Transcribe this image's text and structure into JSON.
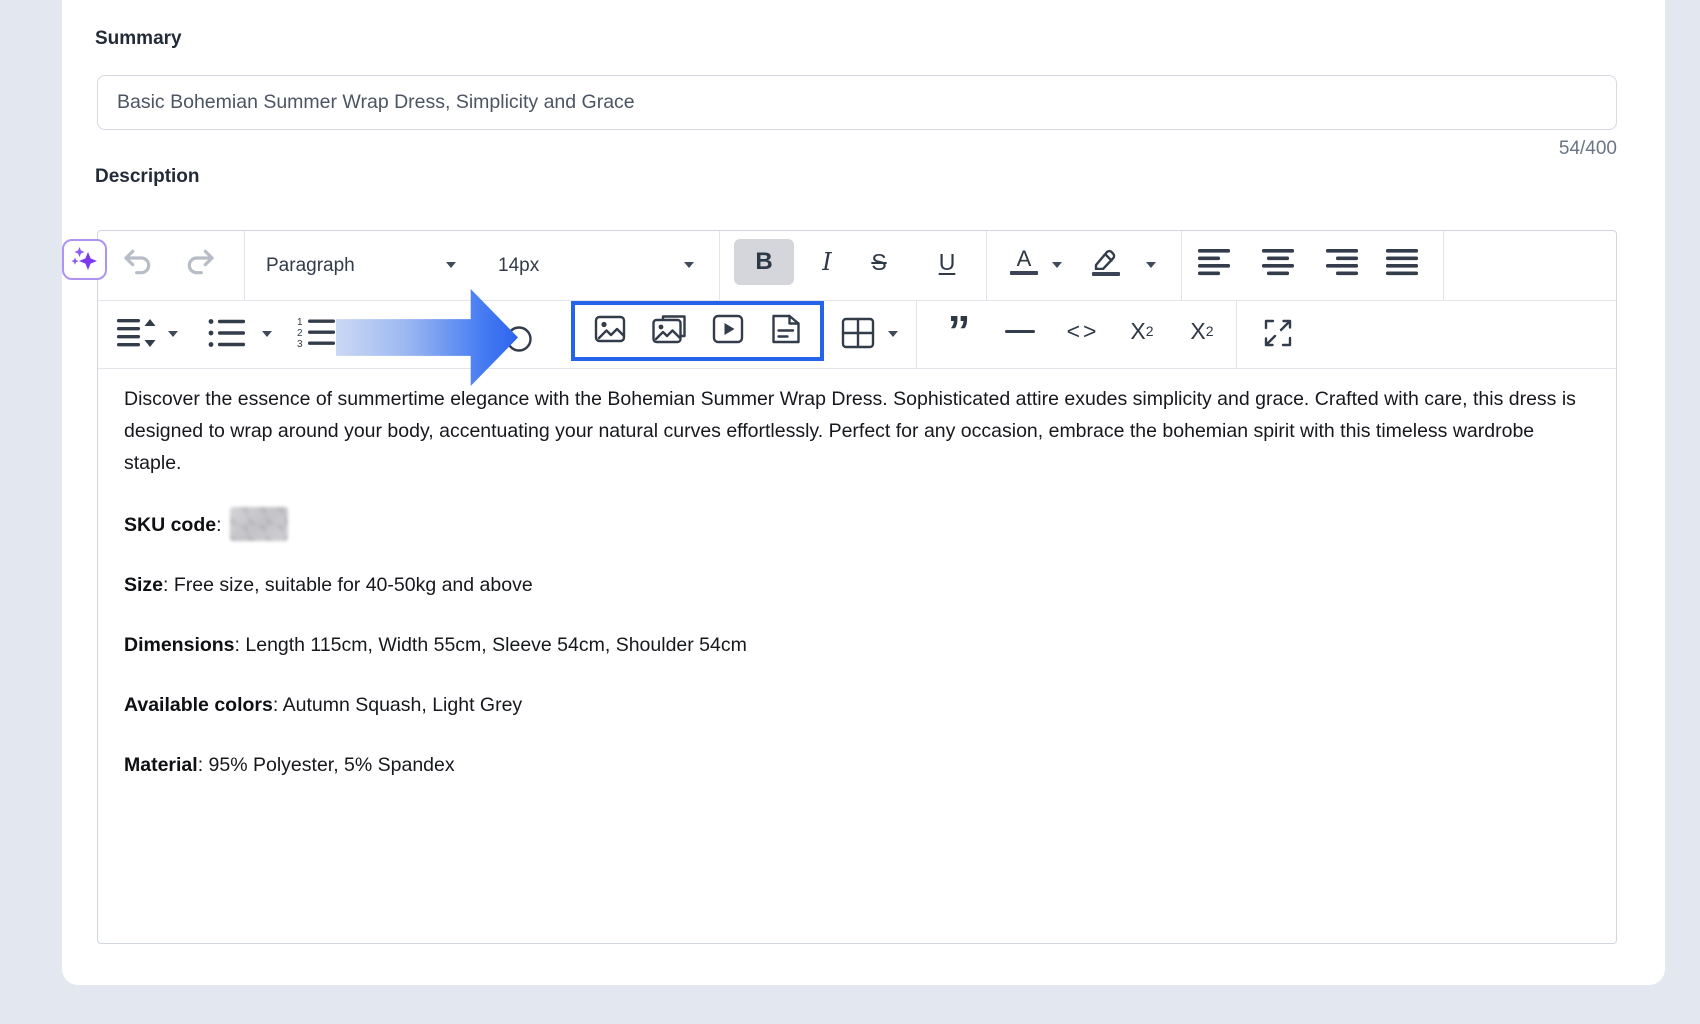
{
  "page": {
    "background": "#e3e7f0",
    "card_background": "#ffffff"
  },
  "summary": {
    "label": "Summary",
    "value": "Basic Bohemian Summer Wrap Dress, Simplicity and Grace",
    "counter": "54/400"
  },
  "description": {
    "label": "Description"
  },
  "toolbar": {
    "paragraph_dropdown": "Paragraph",
    "fontsize_dropdown": "14px",
    "bold": "B",
    "italic": "I",
    "strikethrough": "S",
    "underline": "U",
    "forecolor": "A",
    "code": "<>",
    "superscript_base": "X",
    "superscript_script": "2",
    "subscript_base": "X",
    "subscript_script": "2",
    "quote_glyph": "”",
    "numbered_digits": [
      "1",
      "2",
      "3"
    ]
  },
  "editor": {
    "paragraph": "Discover the essence of summertime elegance with the Bohemian Summer Wrap Dress. Sophisticated attire exudes simplicity and grace. Crafted with care, this dress is designed to wrap around your body, accentuating your natural curves effortlessly. Perfect for any occasion, embrace the bohemian spirit with this timeless wardrobe staple.",
    "separator": ": ",
    "features": [
      {
        "label": "SKU code",
        "value": ""
      },
      {
        "label": "Size",
        "value": "Free size, suitable for 40-50kg and above"
      },
      {
        "label": "Dimensions",
        "value": "Length 115cm, Width 55cm, Sleeve 54cm, Shoulder 54cm"
      },
      {
        "label": "Available colors",
        "value": "Autumn Squash, Light Grey"
      },
      {
        "label": "Material",
        "value": "95% Polyester, 5% Spandex"
      }
    ]
  },
  "colors": {
    "annotation_blue": "#2563eb",
    "arrow_gradient_start": "#ccd8f5",
    "arrow_gradient_end": "#2d63ef",
    "ai_purple": "#8b5cf6",
    "active_button_bg": "#d4d6db"
  }
}
